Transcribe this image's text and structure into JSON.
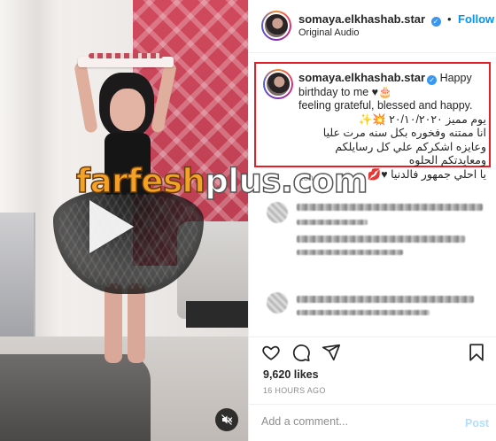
{
  "watermark": {
    "part1": "farfesh",
    "part2": "plus.com"
  },
  "post": {
    "username": "somaya.elkhashab.star",
    "follow_label": "Follow",
    "dot": "•",
    "audio_label": "Original Audio"
  },
  "caption": {
    "username": "somaya.elkhashab.star",
    "line1": "Happy birthday to me ♥🎂",
    "line2": "feeling grateful, blessed and happy.",
    "line3": "يوم مميز ٢٠/١٠/٢٠٢٠ 💥✨",
    "line4": "انا ممتنه وفخوره بكل سنه مرت عليا وعايزه اشكركم علي كل رسايلكم ومعايدتكم الحلوه",
    "line5": "يا احلي جمهور فالدنيا ♥💋",
    "time": "16h"
  },
  "stats": {
    "likes": "9,620 likes",
    "time_ago": "16 HOURS AGO"
  },
  "add_comment": {
    "placeholder": "Add a comment...",
    "post_label": "Post"
  },
  "icons": [
    "play-icon",
    "mute-icon",
    "verified-badge-icon",
    "heart-icon",
    "comment-icon",
    "share-icon",
    "bookmark-icon"
  ]
}
